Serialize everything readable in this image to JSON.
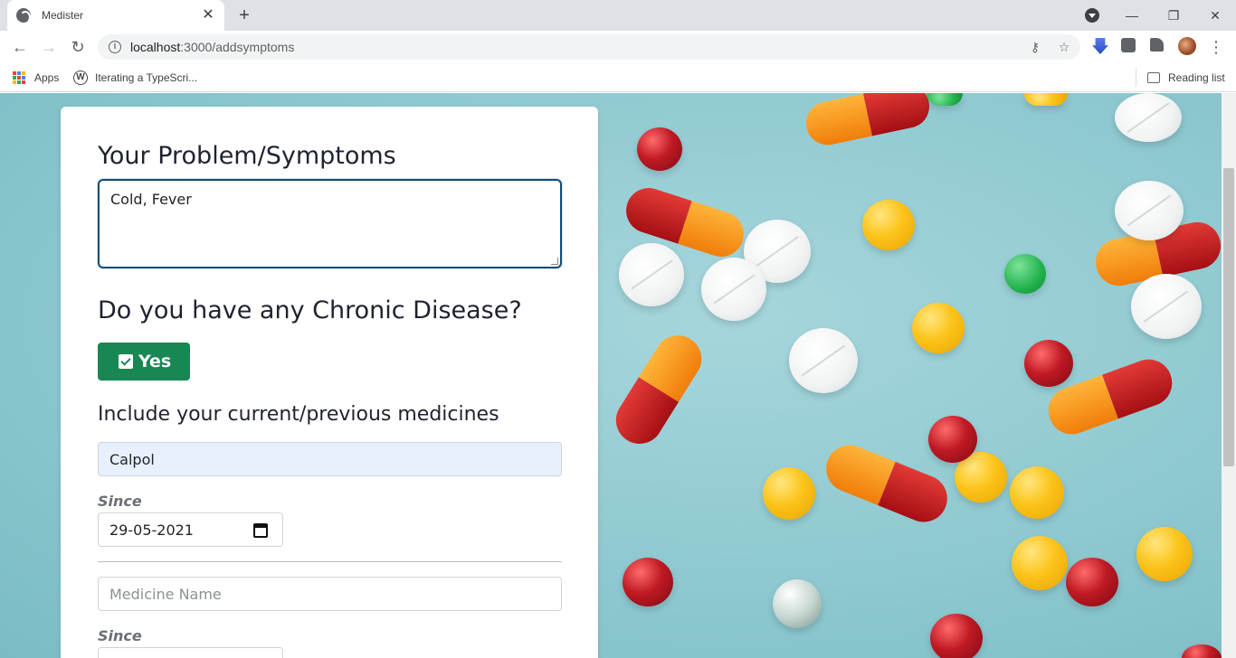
{
  "browser": {
    "tab_title": "Medister",
    "tab_close": "✕",
    "new_tab": "+",
    "url_host": "localhost",
    "url_path": ":3000/addsymptoms",
    "window_controls": {
      "minimize": "—",
      "restore": "❐",
      "close": "✕"
    },
    "bookmarks": {
      "apps_label": "Apps",
      "bookmark_1": "Iterating a TypeScri...",
      "reading_list": "Reading list"
    },
    "wp_letter": "W"
  },
  "form": {
    "symptoms_heading": "Your Problem/Symptoms",
    "symptoms_value": "Cold, Fever",
    "chronic_heading": "Do you have any Chronic Disease?",
    "yes_label": "Yes",
    "medicines_heading": "Include your current/previous medicines",
    "medicine_1_value": "Calpol",
    "since_label": "Since",
    "medicine_1_date": "29-05-2021",
    "medicine_2_placeholder": "Medicine Name",
    "since_label_2": "Since"
  },
  "colors": {
    "accent_green": "#198754",
    "focus_border": "#0e4d7a",
    "autofill_bg": "#e8f0fe"
  },
  "icons": [
    "globe-icon",
    "close-icon",
    "plus-icon",
    "back-icon",
    "forward-icon",
    "reload-icon",
    "info-icon",
    "key-icon",
    "star-icon",
    "extension-icon",
    "menu-icon",
    "apps-icon",
    "wordpress-icon",
    "reading-list-icon",
    "check-icon",
    "calendar-icon"
  ]
}
